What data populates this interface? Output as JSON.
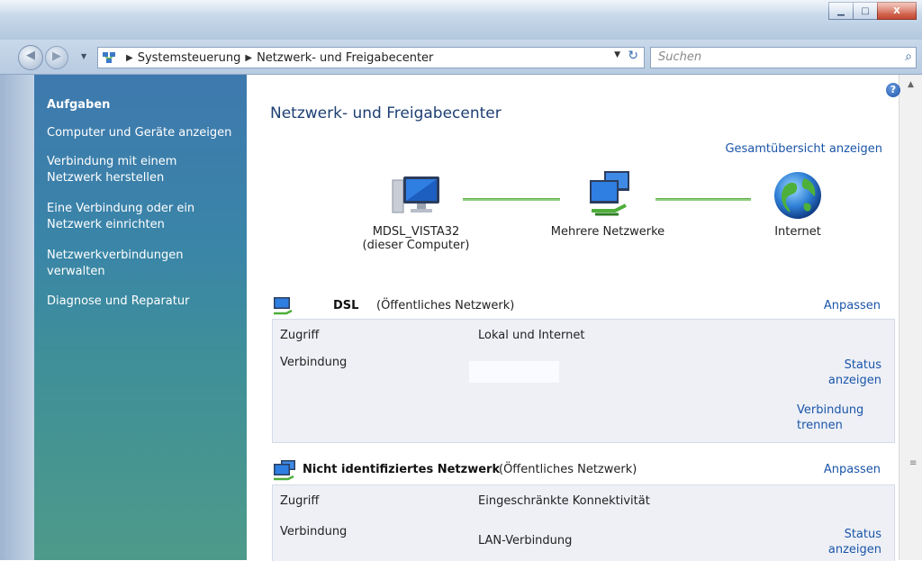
{
  "window": {
    "buttons": {
      "minimize": "▁",
      "maximize": "□",
      "close": "X"
    }
  },
  "navigation": {
    "breadcrumbs": [
      "Systemsteuerung",
      "Netzwerk- und Freigabecenter"
    ],
    "search_placeholder": "Suchen"
  },
  "sidebar": {
    "title": "Aufgaben",
    "items": [
      {
        "label": "Computer und Geräte anzeigen"
      },
      {
        "label": "Verbindung mit einem Netzwerk herstellen"
      },
      {
        "label": "Eine Verbindung oder ein Netzwerk einrichten"
      },
      {
        "label": "Netzwerkverbindungen verwalten"
      },
      {
        "label": "Diagnose und Reparatur"
      }
    ]
  },
  "main": {
    "title": "Netzwerk- und Freigabecenter",
    "overview_link": "Gesamtübersicht anzeigen",
    "map": {
      "computer_name": "MDSL_VISTA32",
      "computer_caption": "(dieser Computer)",
      "network_label": "Mehrere Netzwerke",
      "internet_label": "Internet"
    },
    "networks": [
      {
        "name": "DSL",
        "type": "(Öffentliches Netzwerk)",
        "customize": "Anpassen",
        "access_label": "Zugriff",
        "access_value": "Lokal und Internet",
        "connection_label": "Verbindung",
        "connection_value": "",
        "status_link": "Status anzeigen",
        "disconnect_link": "Verbindung trennen"
      },
      {
        "name": "Nicht identifiziertes Netzwerk",
        "type": "(Öffentliches Netzwerk)",
        "customize": "Anpassen",
        "access_label": "Zugriff",
        "access_value": "Eingeschränkte Konnektivität",
        "connection_label": "Verbindung",
        "connection_value": "LAN-Verbindung",
        "status_link": "Status anzeigen"
      }
    ]
  },
  "icons": {
    "address": "network-center-icon",
    "computer": "computer-icon",
    "networks": "multiple-networks-icon",
    "internet": "globe-icon",
    "network_small": "network-small-icon",
    "help": "help-icon"
  },
  "colors": {
    "sidebar_top": "#3e79ae",
    "sidebar_bottom": "#4e9a8a",
    "link": "#1a55a8",
    "title": "#1e3f73"
  }
}
